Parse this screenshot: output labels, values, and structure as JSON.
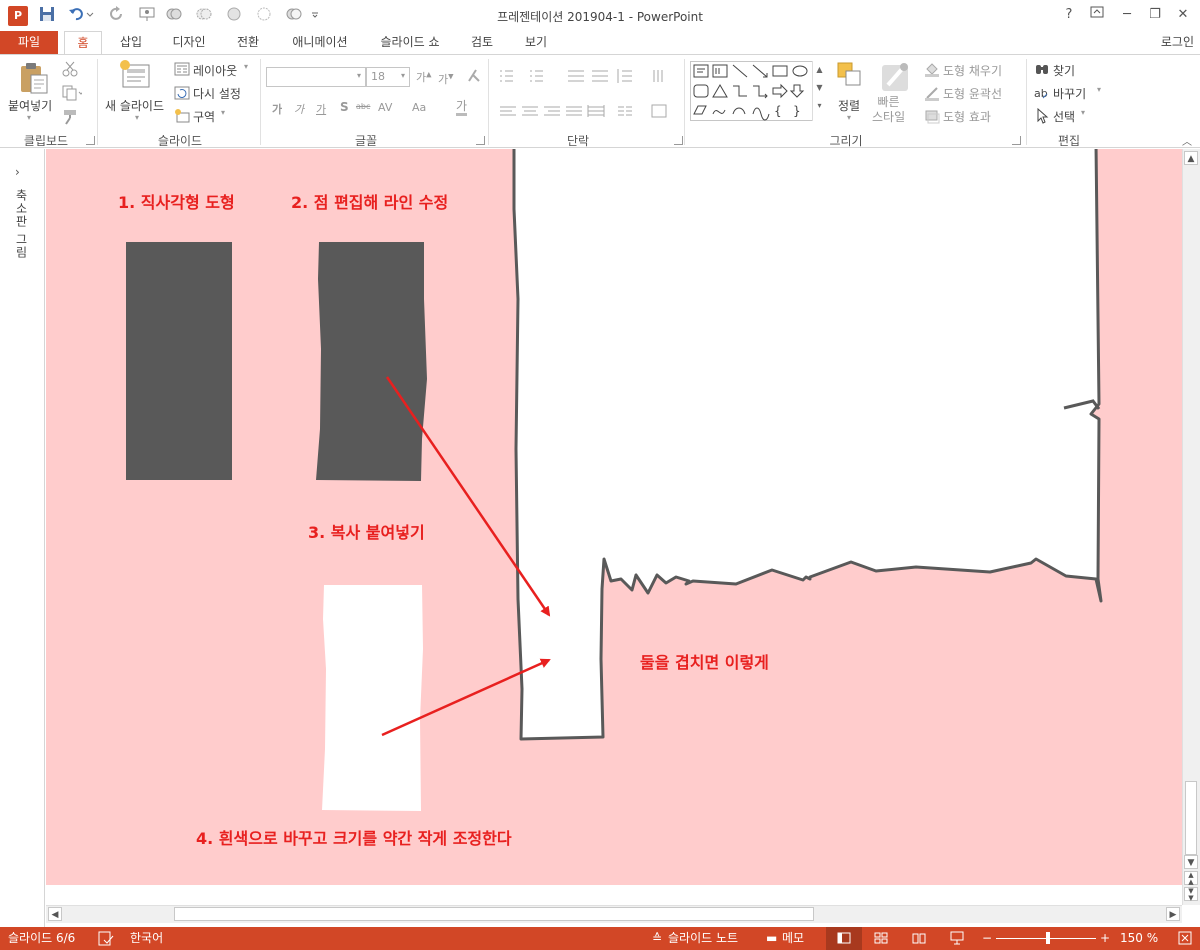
{
  "window": {
    "title": "프레젠테이션 201904-1 - PowerPoint",
    "app_icon_letter": "P",
    "help": "?",
    "minimize": "─",
    "restore": "❐",
    "close": "✕"
  },
  "tabs": {
    "file": "파일",
    "items": [
      "홈",
      "삽입",
      "디자인",
      "전환",
      "애니메이션",
      "슬라이드 쇼",
      "검토",
      "보기"
    ],
    "active": "홈",
    "login": "로그인"
  },
  "ribbon": {
    "clipboard": {
      "label": "클립보드",
      "paste": "붙여넣기"
    },
    "slides": {
      "label": "슬라이드",
      "new_slide": "새 슬라이드",
      "layout": "레이아웃",
      "reset": "다시 설정",
      "section": "구역"
    },
    "font": {
      "label": "글꼴",
      "size": "18",
      "bold": "가",
      "italic": "가",
      "underline": "가",
      "shadow": "S",
      "strike": "abc",
      "spacing": "AV",
      "case": "Aa",
      "color": "가"
    },
    "paragraph": {
      "label": "단락"
    },
    "drawing": {
      "label": "그리기",
      "arrange": "정렬",
      "quick_styles": "빠른\n스타일",
      "fill": "도형 채우기",
      "outline": "도형 윤곽선",
      "effects": "도형 효과"
    },
    "editing": {
      "label": "편집",
      "find": "찾기",
      "replace": "바꾸기",
      "select": "선택"
    }
  },
  "thumb_pane": {
    "label": "축소판 그림",
    "expand": "›"
  },
  "slide": {
    "step1": "1. 직사각형 도형",
    "step2": "2. 점 편집해 라인 수정",
    "step3": "3. 복사 붙여넣기",
    "step4": "4. 흰색으로 바꾸고 크기를 약간 작게 조정한다",
    "overlap": "둘을 겹치면 이렇게",
    "colors": {
      "background": "#ffcccc",
      "dark_shape": "#595959",
      "text": "#e8201f",
      "arrow": "#e8201f",
      "outline": "#595959"
    }
  },
  "status": {
    "slide": "슬라이드 6/6",
    "language": "한국어",
    "notes": "슬라이드 노트",
    "comments": "메모",
    "zoom": "150 %"
  }
}
